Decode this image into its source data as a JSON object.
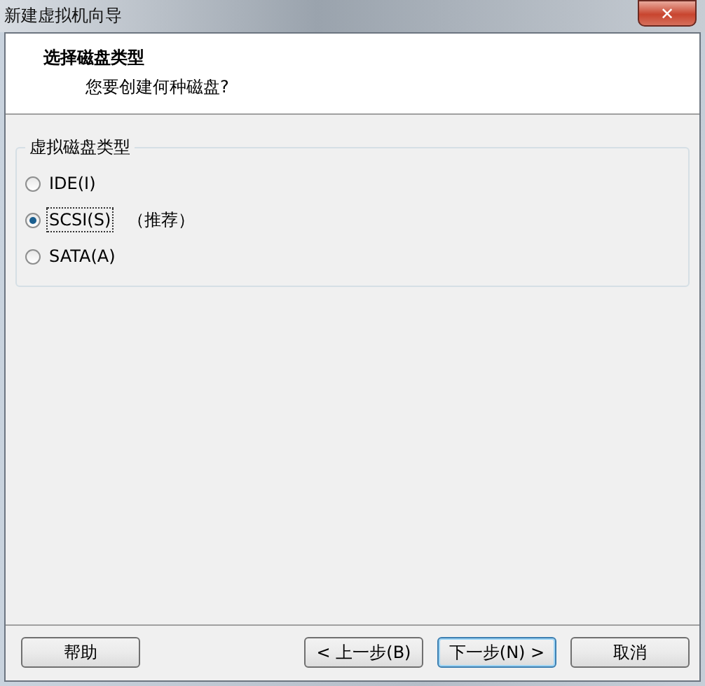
{
  "window": {
    "title": "新建虚拟机向导",
    "close": "✕"
  },
  "header": {
    "title": "选择磁盘类型",
    "subtitle": "您要创建何种磁盘?"
  },
  "group": {
    "title": "虚拟磁盘类型",
    "options": [
      {
        "label": "IDE(I)",
        "selected": false
      },
      {
        "label": "SCSI(S)",
        "selected": true,
        "note": "（推荐）"
      },
      {
        "label": "SATA(A)",
        "selected": false
      }
    ]
  },
  "buttons": [
    {
      "label": "帮助",
      "default": false
    },
    {
      "label": "< 上一步(B)",
      "default": false
    },
    {
      "label": "下一步(N) >",
      "default": true
    },
    {
      "label": "取消",
      "default": false
    }
  ]
}
